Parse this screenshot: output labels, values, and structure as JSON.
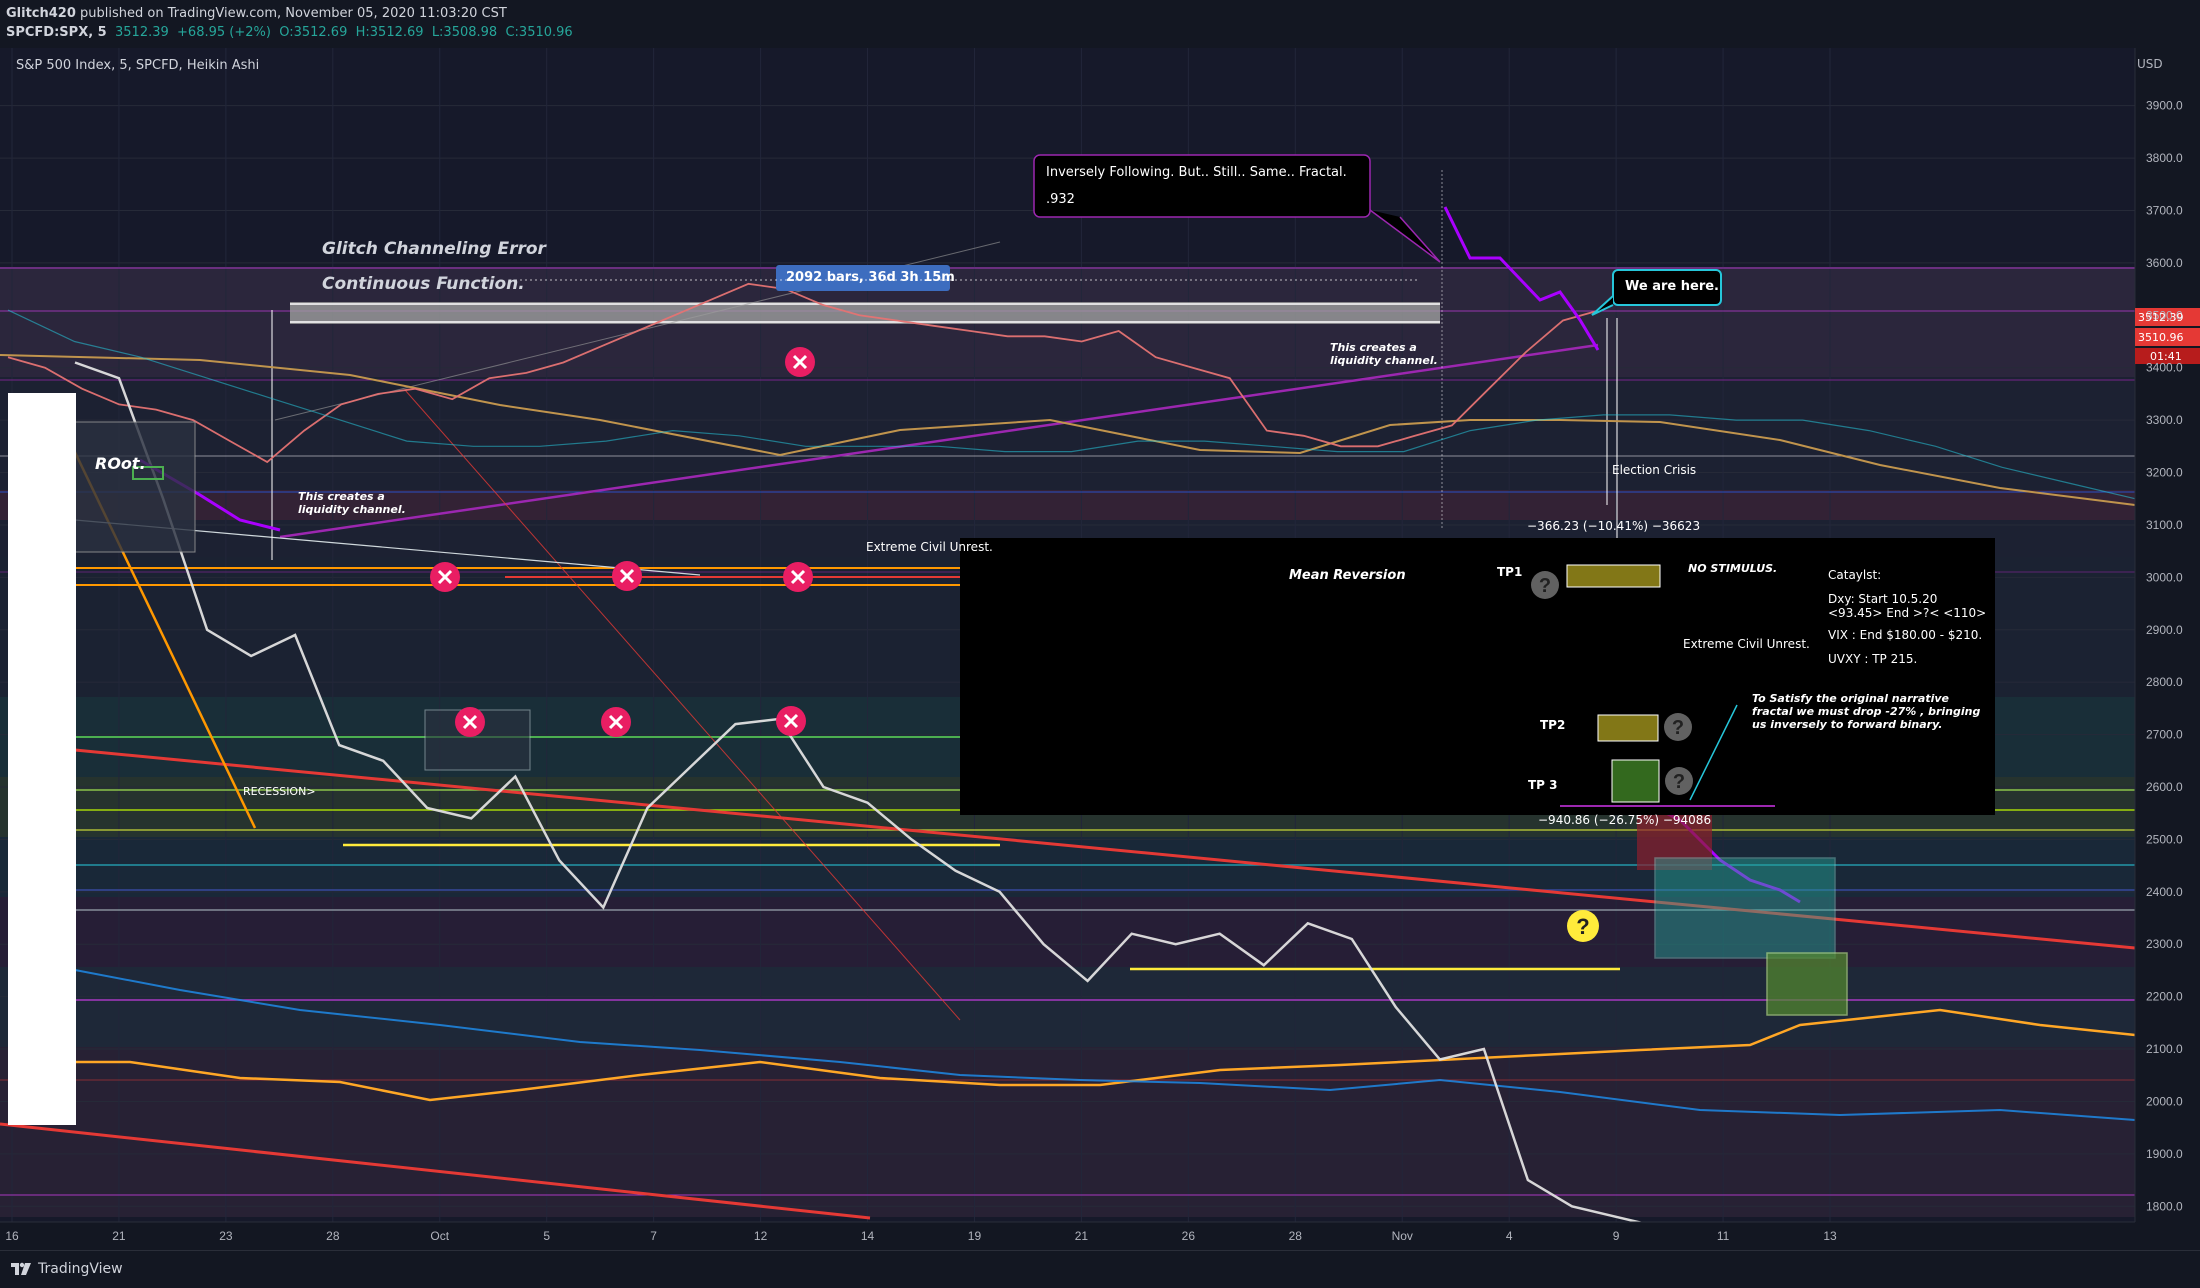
{
  "header": {
    "publisher_user": "Glitch420",
    "publisher_text": "published on TradingView.com, November 05, 2020 11:03:20 CST",
    "symbol": "SPCFD:SPX, 5",
    "last": "3512.39",
    "change": "+68.95 (+2%)",
    "open": "O:3512.69",
    "high": "H:3512.69",
    "low": "L:3508.98",
    "close": "C:3510.96"
  },
  "chart_title": "S&P 500 Index, 5, SPCFD, Heikin Ashi",
  "currency": "USD",
  "footer_brand": "TradingView",
  "colors": {
    "bg": "#131722",
    "purple": "#9c27b0",
    "red": "#e53935",
    "orange": "#ff9800",
    "yellow": "#ffeb3b",
    "green": "#4caf50",
    "white": "#ffffff"
  },
  "annotations": {
    "glitch_channeling": "Glitch Channeling Error",
    "continuous": "Continuous Function.",
    "bars_badge": "2092 bars, 36d 3h 15m",
    "inversely_line1": "Inversely Following. But.. Still.. Same.. Fractal.",
    "inversely_line2": ".932",
    "we_are_here": "We are here.",
    "liquidity_right": "This creates a liquidity channel.",
    "liquidity_left": "This creates a liquidity channel.",
    "root": "ROot.",
    "election_crisis": "Election Crisis",
    "measure1": "−366.23 (−10.41%) −36623",
    "extreme_civil_left": "Extreme Civil Unrest.",
    "mean_reversion": "Mean Reversion",
    "tp1": "TP1",
    "no_stimulus": "NO STIMULUS.",
    "catalyst": "Cataylst:",
    "dxy": "Dxy: Start 10.5.20 <93.45> End >?< <110>",
    "vix": "VIX : End $180.00 - $210.",
    "uvxy": "UVXY : TP 215.",
    "extreme_civil_right": "Extreme Civil Unrest.",
    "satisfy": "To Satisfy the original narrative fractal we must drop -27% , bringing us inversely to forward binary.",
    "tp2": "TP2",
    "tp3": "TP 3",
    "measure2": "−940.86 (−26.75%) −94086",
    "recession": "RECESSION>"
  },
  "chart_data": {
    "type": "line",
    "title": "S&P 500 Index, 5, SPCFD, Heikin Ashi",
    "x_ticks": [
      "16",
      "21",
      "23",
      "28",
      "Oct",
      "5",
      "7",
      "12",
      "14",
      "19",
      "21",
      "26",
      "28",
      "Nov",
      "4",
      "9",
      "11",
      "13"
    ],
    "y_ticks": [
      3900,
      3800,
      3700,
      3600,
      3500,
      3400,
      3300,
      3200,
      3100,
      3000,
      2900,
      2800,
      2700,
      2600,
      2500,
      2400,
      2300,
      2200,
      2100,
      2000,
      1900,
      1800
    ],
    "ylim": [
      1770,
      4010
    ],
    "price_tags": [
      "3512.39",
      "3510.96",
      "01:41"
    ],
    "grid": true,
    "series": [
      {
        "name": "",
        "values": [
          3420,
          3400,
          3360,
          3330,
          3320,
          3300,
          3260,
          3220,
          3280,
          3330,
          3350,
          3360,
          3340,
          3380,
          3390,
          3410,
          3440,
          3470,
          3500,
          3530,
          3560,
          3550,
          3520,
          3500,
          3490,
          3480,
          3470,
          3460,
          3460,
          3450,
          3470,
          3420,
          3400,
          3380,
          3280,
          3270,
          3250,
          3250,
          3270,
          3290,
          3360,
          3430,
          3490,
          3510
        ]
      },
      {
        "name": "",
        "values": [
          3410,
          3380,
          3150,
          2900,
          2850,
          2890,
          2680,
          2650,
          2560,
          2540,
          2620,
          2460,
          2370,
          2560,
          2640,
          2720,
          2730,
          2600,
          2570,
          2500,
          2440,
          2400,
          2300,
          2230,
          2320,
          2300,
          2320,
          2260,
          2340,
          2310,
          2180,
          2080,
          2100,
          1850,
          1800,
          1780,
          1760
        ]
      },
      {
        "name": "",
        "values": [
          3510,
          3450,
          3420,
          3380,
          3340,
          3300,
          3260,
          3250,
          3250,
          3260,
          3280,
          3270,
          3250,
          3250,
          3250,
          3240,
          3240,
          3260,
          3260,
          3250,
          3240,
          3240,
          3280,
          3300,
          3310,
          3310,
          3300,
          3300,
          3280,
          3250,
          3210,
          3180,
          3150
        ]
      }
    ]
  }
}
